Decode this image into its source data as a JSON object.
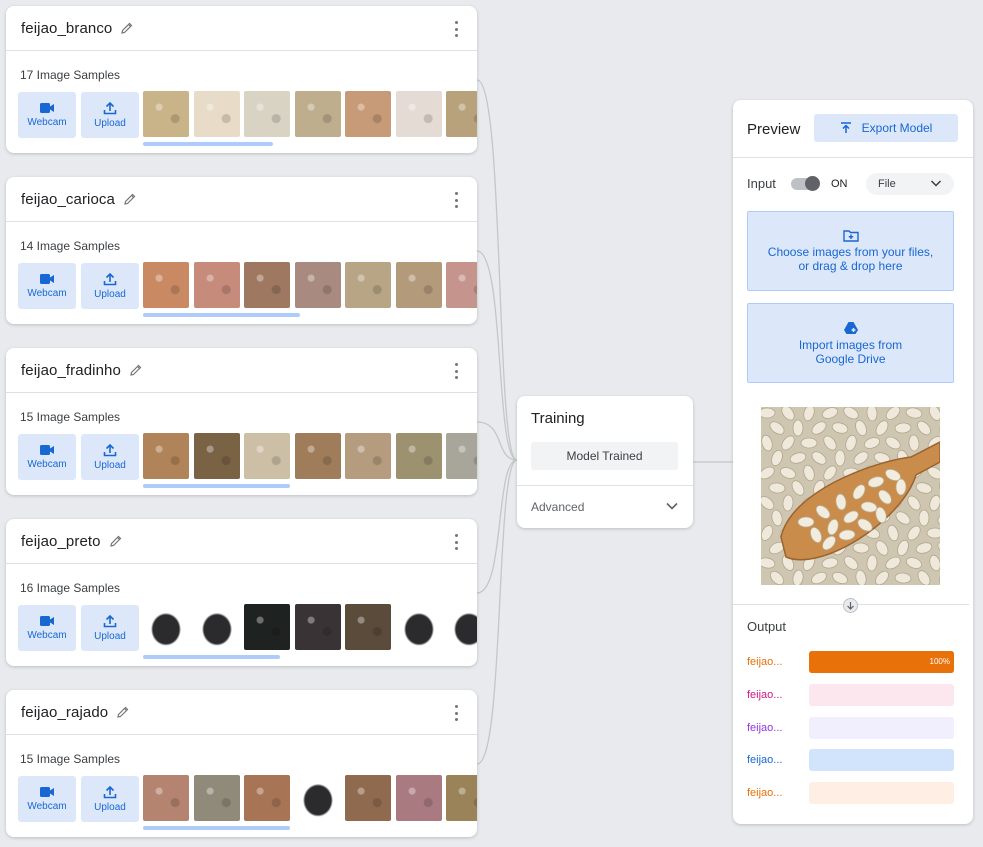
{
  "classes": [
    {
      "name": "feijao_branco",
      "samples": "17 Image Samples",
      "webcam": "Webcam",
      "upload": "Upload",
      "thumbs": [
        "#c9b48a",
        "#e8dcc8",
        "#d9d3c4",
        "#bfae8e",
        "#c79a78",
        "#e4dcd4",
        "#b8a27c"
      ],
      "scroll_fraction": 0.39
    },
    {
      "name": "feijao_carioca",
      "samples": "14 Image Samples",
      "webcam": "Webcam",
      "upload": "Upload",
      "thumbs": [
        "#c98a63",
        "#c68b7a",
        "#9e7860",
        "#a88a80",
        "#b7a585",
        "#b39a7a",
        "#c5948c"
      ],
      "scroll_fraction": 0.47
    },
    {
      "name": "feijao_fradinho",
      "samples": "15 Image Samples",
      "webcam": "Webcam",
      "upload": "Upload",
      "thumbs": [
        "#b08458",
        "#7a6245",
        "#cdbfa6",
        "#a07d5a",
        "#b59c7e",
        "#9c9270",
        "#a8a59a"
      ],
      "scroll_fraction": 0.44
    },
    {
      "name": "feijao_preto",
      "samples": "16 Image Samples",
      "webcam": "Webcam",
      "upload": "Upload",
      "thumbs": [
        "#ffffff",
        "#ffffff",
        "#1e2220",
        "#3a3336",
        "#5a4b3a",
        "#ffffff",
        "#ffffff"
      ],
      "scroll_fraction": 0.41
    },
    {
      "name": "feijao_rajado",
      "samples": "15 Image Samples",
      "webcam": "Webcam",
      "upload": "Upload",
      "thumbs": [
        "#b48470",
        "#8f8a7a",
        "#a77455",
        "#ffffff",
        "#8f6a4f",
        "#a97a80",
        "#9a8358"
      ],
      "scroll_fraction": 0.44
    }
  ],
  "training": {
    "title": "Training",
    "status_button": "Model Trained",
    "advanced": "Advanced"
  },
  "preview": {
    "title": "Preview",
    "export_button": "Export Model",
    "input_label": "Input",
    "toggle_label": "ON",
    "toggle_on": true,
    "input_source": "File",
    "file_drop_line1": "Choose images from your files,",
    "file_drop_line2": "or drag & drop here",
    "drive_line1": "Import images from",
    "drive_line2": "Google Drive",
    "output_label": "Output",
    "outputs": [
      {
        "name": "feijao...",
        "value": 1.0,
        "label": "100%",
        "text_color": "#e8710a",
        "bar_bg": "#e8710a",
        "fill": "#e8710a"
      },
      {
        "name": "feijao...",
        "value": 0.0,
        "label": "",
        "text_color": "#d01884",
        "bar_bg": "#fde7ee",
        "fill": "#d01884"
      },
      {
        "name": "feijao...",
        "value": 0.0,
        "label": "",
        "text_color": "#9334e6",
        "bar_bg": "#f1effd",
        "fill": "#9334e6"
      },
      {
        "name": "feijao...",
        "value": 0.0,
        "label": "",
        "text_color": "#1967d2",
        "bar_bg": "#d2e3fc",
        "fill": "#1967d2"
      },
      {
        "name": "feijao...",
        "value": 0.0,
        "label": "",
        "text_color": "#e8710a",
        "bar_bg": "#feeee3",
        "fill": "#e8710a"
      }
    ]
  }
}
